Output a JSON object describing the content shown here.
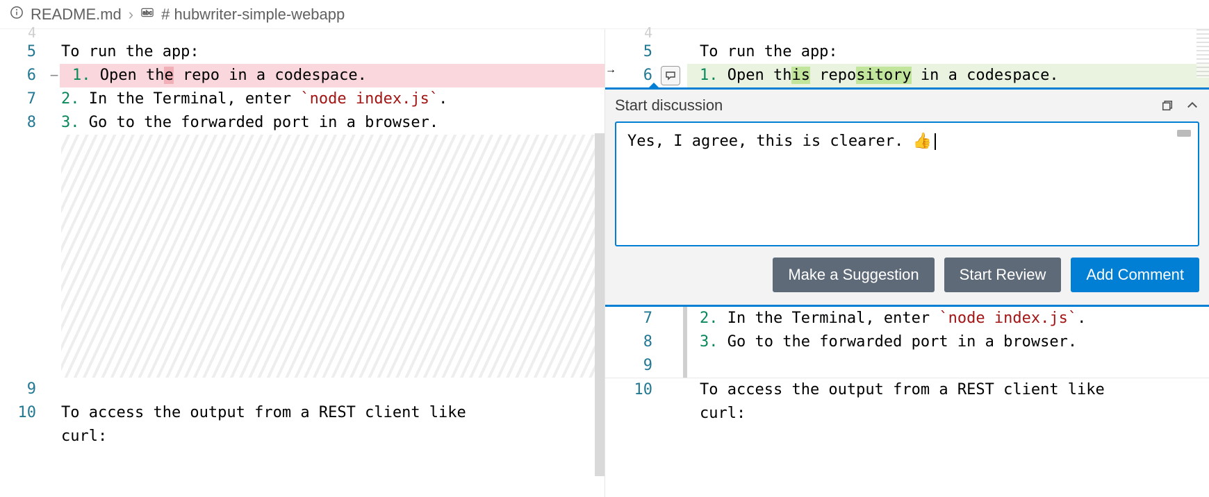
{
  "breadcrumb": {
    "file": "README.md",
    "heading": "# hubwriter-simple-webapp"
  },
  "left": {
    "lines": [
      {
        "n": 4,
        "peek": true
      },
      {
        "n": 5,
        "text": "To run the app:"
      },
      {
        "n": 6,
        "deleted": true,
        "prefix": "1.",
        "text_a": " Open th",
        "hl": "e",
        "text_b": " repo in a codespace."
      },
      {
        "n": 7,
        "prefix": "2.",
        "text_a": " In the Terminal, enter ",
        "code": "`node index.js`",
        "text_b": "."
      },
      {
        "n": 8,
        "prefix": "3.",
        "text_a": " Go to the forwarded port in a browser."
      },
      {
        "n": 9,
        "text": ""
      },
      {
        "n": 10,
        "text": "To access the output from a REST client like "
      },
      {
        "cont": true,
        "text": "curl:"
      }
    ]
  },
  "right": {
    "lines_top": [
      {
        "n": 4,
        "peek": true
      },
      {
        "n": 5,
        "text": "To run the app:"
      },
      {
        "n": 6,
        "added": true,
        "has_arrow": true,
        "has_comment": true,
        "prefix": "1.",
        "text_a": " Open th",
        "hl1": "is",
        "text_b": " repo",
        "hl2": "sitory",
        "text_c": " in a codespace."
      }
    ],
    "lines_bottom": [
      {
        "n": 7,
        "prefix": "2.",
        "text_a": " In the Terminal, enter ",
        "code": "`node index.js`",
        "text_b": "."
      },
      {
        "n": 8,
        "prefix": "3.",
        "text_a": " Go to the forwarded port in a browser."
      },
      {
        "n": 9,
        "text": ""
      },
      {
        "n": 10,
        "text": "To access the output from a REST client like "
      },
      {
        "cont": true,
        "text": "curl:"
      }
    ]
  },
  "discussion": {
    "title": "Start discussion",
    "text": "Yes, I agree, this is clearer. 👍",
    "buttons": {
      "suggestion": "Make a Suggestion",
      "review": "Start Review",
      "comment": "Add Comment"
    }
  }
}
